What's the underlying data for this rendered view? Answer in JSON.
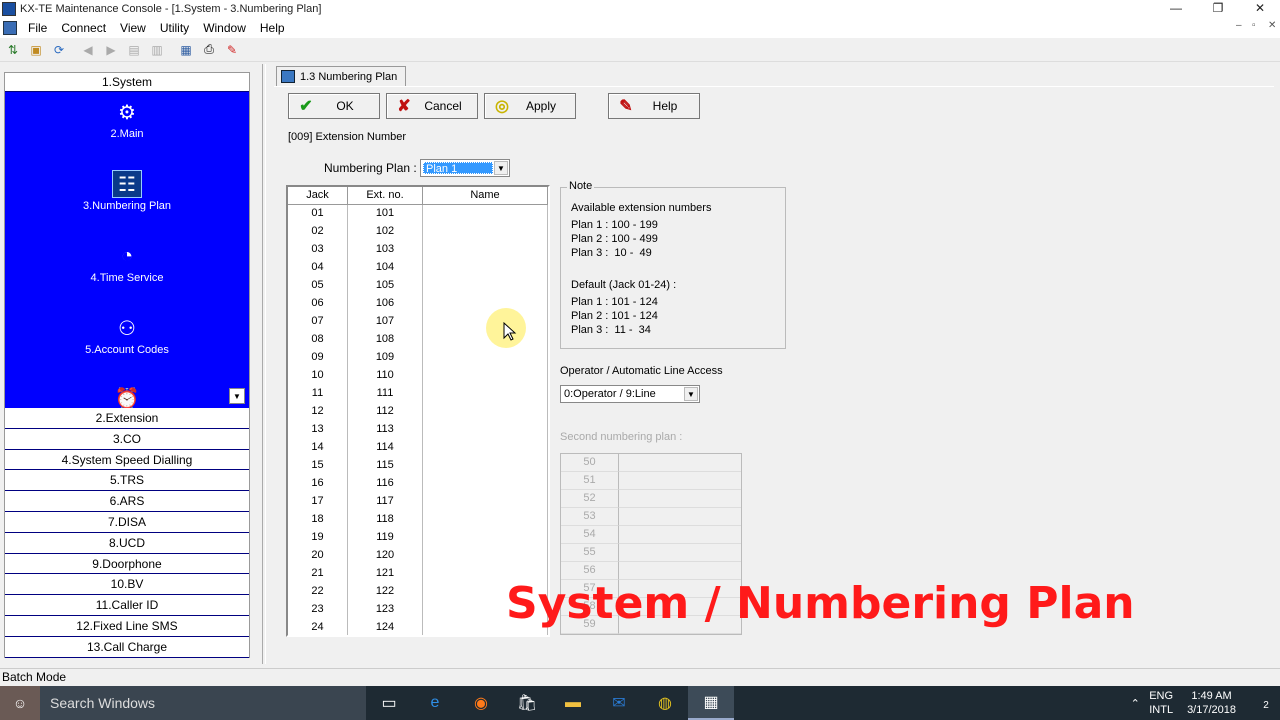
{
  "window": {
    "title": "KX-TE Maintenance Console - [1.System - 3.Numbering Plan]",
    "controls": [
      "—",
      "❐",
      "✕"
    ]
  },
  "menu": [
    "File",
    "Connect",
    "View",
    "Utility",
    "Window",
    "Help"
  ],
  "mdi_controls": [
    "–",
    "▫",
    "✕"
  ],
  "toolbar_icons": [
    "connect-icon",
    "open-icon",
    "refresh-icon",
    "back-icon",
    "forward-icon",
    "upload-icon",
    "download-icon",
    "report-icon",
    "print-icon",
    "help-icon"
  ],
  "nav": {
    "header": "1.System",
    "icons": [
      {
        "label": "2.Main",
        "glyph": "⚙"
      },
      {
        "label": "3.Numbering Plan",
        "glyph": "☷"
      },
      {
        "label": "4.Time Service",
        "glyph": "◔"
      },
      {
        "label": "5.Account Codes",
        "glyph": "⚇"
      },
      {
        "label": "",
        "glyph": "⏰"
      }
    ],
    "items": [
      "2.Extension",
      "3.CO",
      "4.System Speed Dialling",
      "5.TRS",
      "6.ARS",
      "7.DISA",
      "8.UCD",
      "9.Doorphone",
      "10.BV",
      "11.Caller ID",
      "12.Fixed Line SMS",
      "13.Call Charge"
    ]
  },
  "doc_tab": "1.3 Numbering Plan",
  "buttons": {
    "ok": "OK",
    "cancel": "Cancel",
    "apply": "Apply",
    "help": "Help"
  },
  "section_label": "[009] Extension Number",
  "numbering_plan": {
    "label": "Numbering Plan :",
    "value": "Plan 1"
  },
  "ext_table": {
    "headers": [
      "Jack",
      "Ext. no.",
      "Name"
    ],
    "rows": [
      [
        "01",
        "101",
        ""
      ],
      [
        "02",
        "102",
        ""
      ],
      [
        "03",
        "103",
        ""
      ],
      [
        "04",
        "104",
        ""
      ],
      [
        "05",
        "105",
        ""
      ],
      [
        "06",
        "106",
        ""
      ],
      [
        "07",
        "107",
        ""
      ],
      [
        "08",
        "108",
        ""
      ],
      [
        "09",
        "109",
        ""
      ],
      [
        "10",
        "110",
        ""
      ],
      [
        "11",
        "111",
        ""
      ],
      [
        "12",
        "112",
        ""
      ],
      [
        "13",
        "113",
        ""
      ],
      [
        "14",
        "114",
        ""
      ],
      [
        "15",
        "115",
        ""
      ],
      [
        "16",
        "116",
        ""
      ],
      [
        "17",
        "117",
        ""
      ],
      [
        "18",
        "118",
        ""
      ],
      [
        "19",
        "119",
        ""
      ],
      [
        "20",
        "120",
        ""
      ],
      [
        "21",
        "121",
        ""
      ],
      [
        "22",
        "122",
        ""
      ],
      [
        "23",
        "123",
        ""
      ],
      [
        "24",
        "124",
        ""
      ]
    ]
  },
  "note": {
    "title": "Note",
    "lines": [
      "Available extension numbers",
      "Plan 1 : 100 - 199",
      "Plan 2 : 100 - 499",
      "Plan 3 :  10 -  49",
      "",
      "Default (Jack 01-24) :",
      "Plan 1 : 101 - 124",
      "Plan 2 : 101 - 124",
      "Plan 3 :  11 -  34"
    ]
  },
  "operator": {
    "label": "Operator / Automatic Line Access",
    "value": "0:Operator / 9:Line"
  },
  "second_plan": {
    "label": "Second numbering plan :",
    "rows": [
      "50",
      "51",
      "52",
      "53",
      "54",
      "55",
      "56",
      "57",
      "58",
      "59"
    ]
  },
  "overlay_caption": "System / Numbering Plan",
  "status_bar": "Batch Mode",
  "taskbar": {
    "search_placeholder": "Search Windows",
    "apps": [
      "task-view-icon",
      "edge-icon",
      "firefox-icon",
      "store-icon",
      "explorer-icon",
      "outlook-icon",
      "chrome-icon",
      "console-icon"
    ],
    "lang": [
      "ENG",
      "INTL"
    ],
    "time": "1:49 AM",
    "date": "3/17/2018",
    "notification_count": "2"
  }
}
